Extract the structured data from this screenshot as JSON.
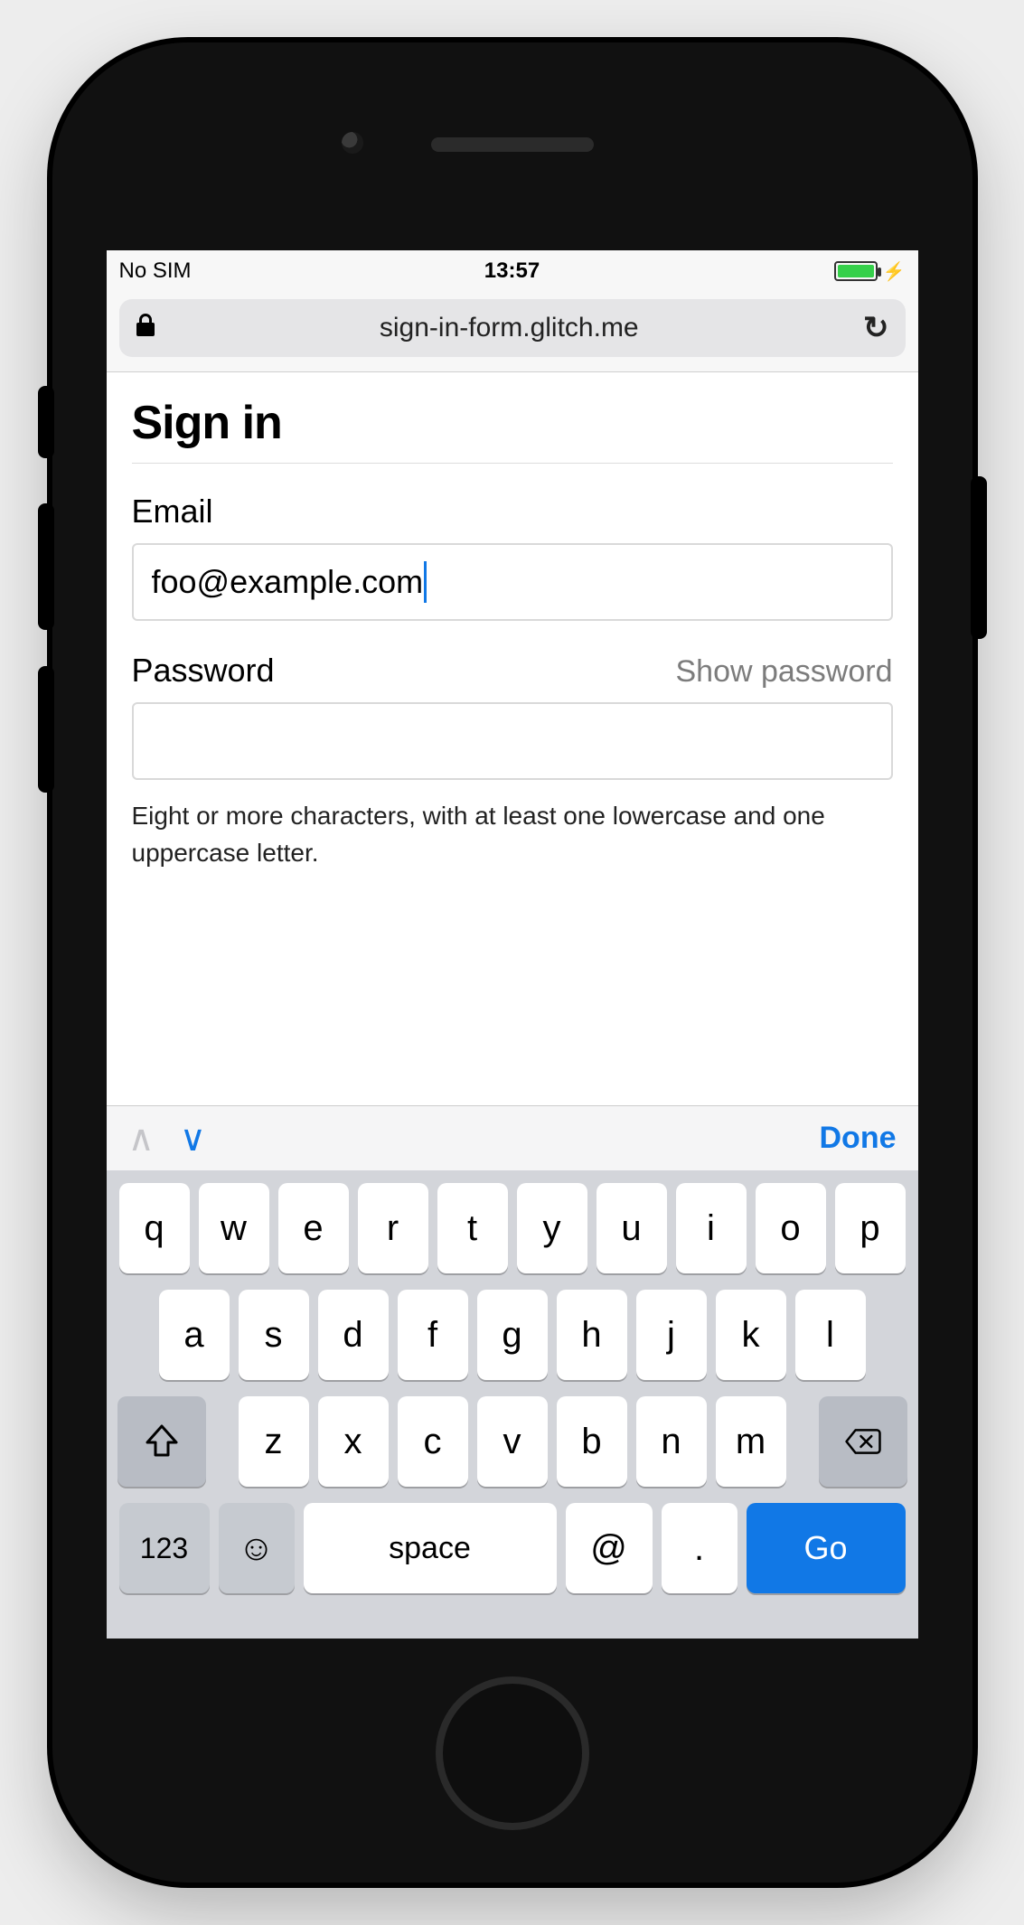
{
  "status": {
    "carrier": "No SIM",
    "time": "13:57"
  },
  "browser": {
    "url": "sign-in-form.glitch.me"
  },
  "page": {
    "title": "Sign in",
    "email_label": "Email",
    "email_value": "foo@example.com",
    "password_label": "Password",
    "password_show_label": "Show password",
    "password_value": "",
    "password_hint": "Eight or more characters, with at least one lowercase and one uppercase letter."
  },
  "accessory": {
    "done_label": "Done"
  },
  "keyboard": {
    "row1": [
      "q",
      "w",
      "e",
      "r",
      "t",
      "y",
      "u",
      "i",
      "o",
      "p"
    ],
    "row2": [
      "a",
      "s",
      "d",
      "f",
      "g",
      "h",
      "j",
      "k",
      "l"
    ],
    "row3": [
      "z",
      "x",
      "c",
      "v",
      "b",
      "n",
      "m"
    ],
    "num_label": "123",
    "space_label": "space",
    "at_label": "@",
    "dot_label": ".",
    "go_label": "Go"
  }
}
